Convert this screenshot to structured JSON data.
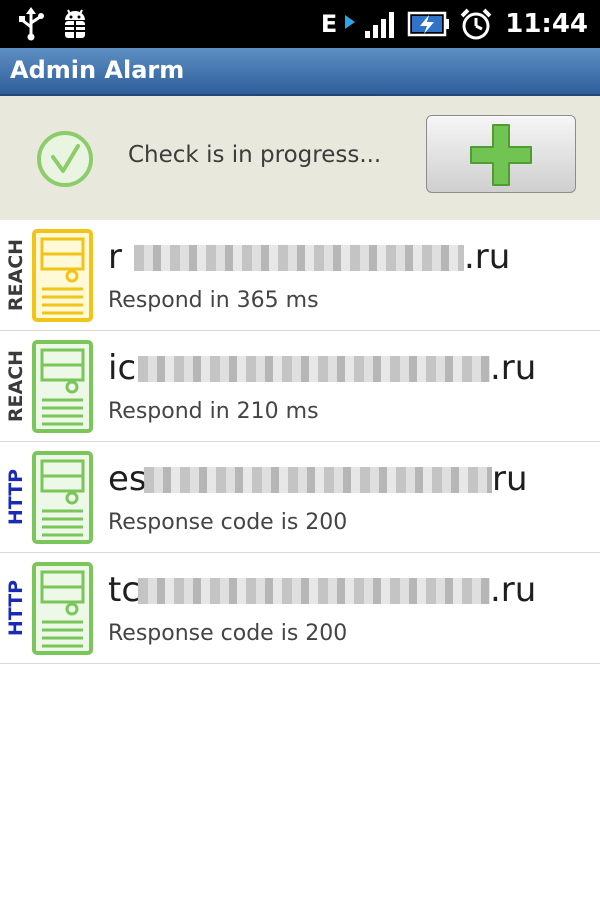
{
  "status_bar": {
    "icons": [
      "usb-icon",
      "android-debug-icon",
      "edge-network-icon",
      "signal-icon",
      "battery-charging-icon",
      "alarm-clock-icon"
    ],
    "network": "E",
    "time": "11:44"
  },
  "app": {
    "title": "Admin Alarm"
  },
  "status_panel": {
    "icon": "check-circle-icon",
    "message": "Check is in progress...",
    "add_button_icon": "plus-icon"
  },
  "colors": {
    "title_bar": "#3f72ad",
    "reach_icon": "#f2c318",
    "ok_icon": "#7ac65a",
    "http_label": "#1a2ab5",
    "reach_label": "#3a3a3a"
  },
  "checks": [
    {
      "type": "REACH",
      "host_prefix": "r",
      "host_suffix": ".ru",
      "detail": "Respond in 365 ms",
      "icon_state": "warning"
    },
    {
      "type": "REACH",
      "host_prefix": "ic",
      "host_suffix": ".ru",
      "detail": "Respond in 210 ms",
      "icon_state": "ok"
    },
    {
      "type": "HTTP",
      "host_prefix": "es",
      "host_suffix": "ru",
      "detail": "Response code is 200",
      "icon_state": "ok"
    },
    {
      "type": "HTTP",
      "host_prefix": "tc",
      "host_suffix": ".ru",
      "detail": "Response code is 200",
      "icon_state": "ok"
    }
  ]
}
